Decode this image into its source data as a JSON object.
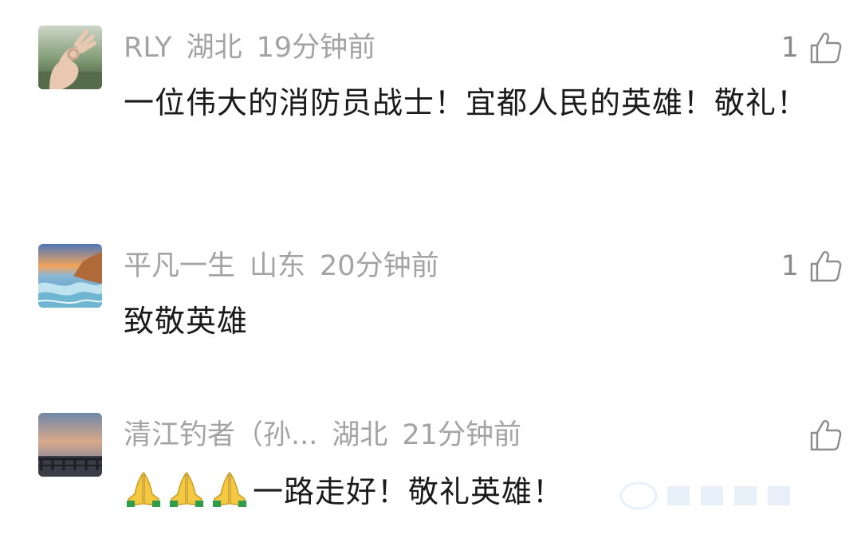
{
  "comments": [
    {
      "username": "RLY",
      "location": "湖北",
      "time": "19分钟前",
      "text": "一位伟大的消防员战士！宜都人民的英雄！敬礼！",
      "likes": "1",
      "avatar_icon": "ok-hand-photo"
    },
    {
      "username": "平凡一生",
      "location": "山东",
      "time": "20分钟前",
      "text": "致敬英雄",
      "likes": "1",
      "avatar_icon": "seascape-photo"
    },
    {
      "username": "清江钓者（孙...",
      "location": "湖北",
      "time": "21分钟前",
      "emoji": [
        "folded-hands",
        "folded-hands",
        "folded-hands"
      ],
      "text": "一路走好！敬礼英雄！",
      "likes": "",
      "avatar_icon": "sunset-bridge-photo"
    }
  ],
  "colors": {
    "meta": "#a3a3a3",
    "text": "#1a1a1a",
    "like": "#8c8c8c"
  }
}
